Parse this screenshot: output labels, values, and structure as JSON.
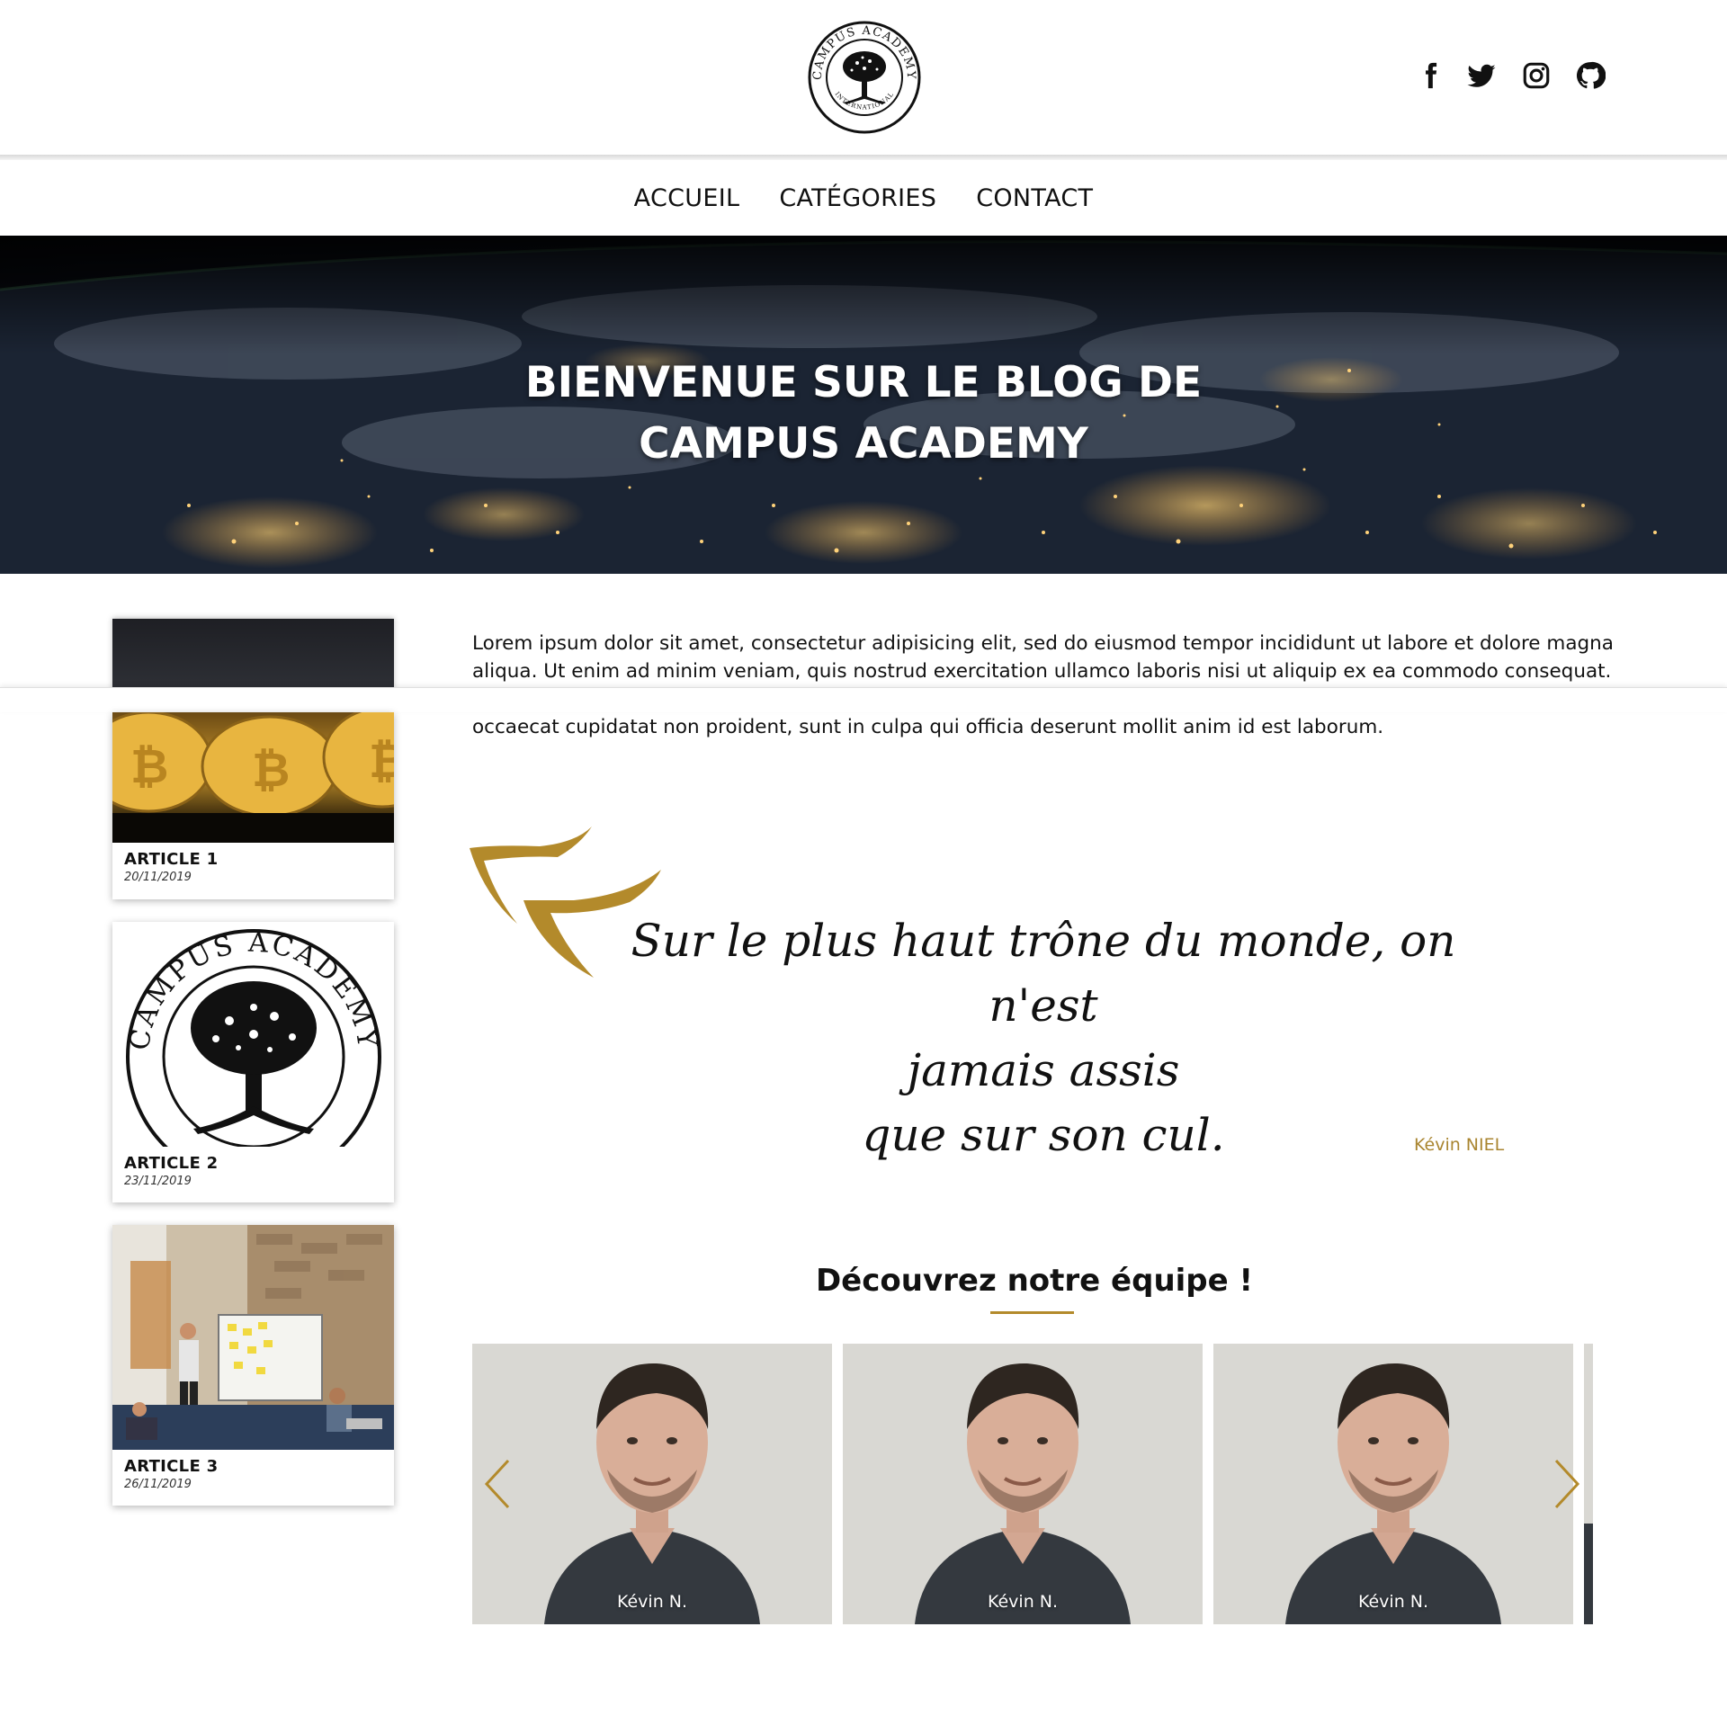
{
  "header": {
    "logo_text": "CAMPUS ACADEMY INTERNATIONAL",
    "social_icons": [
      "facebook-icon",
      "twitter-icon",
      "instagram-icon",
      "github-icon"
    ]
  },
  "nav": {
    "items": [
      {
        "label": "ACCUEIL"
      },
      {
        "label": "CATÉGORIES"
      },
      {
        "label": "CONTACT"
      }
    ]
  },
  "hero": {
    "title_line1": "BIENVENUE SUR LE BLOG DE",
    "title_line2": "CAMPUS ACADEMY"
  },
  "articles": [
    {
      "title": "ARTICLE 1",
      "date": "20/11/2019"
    },
    {
      "title": "ARTICLE 2",
      "date": "23/11/2019"
    },
    {
      "title": "ARTICLE 3",
      "date": "26/11/2019"
    }
  ],
  "intro": {
    "line1": "Lorem ipsum dolor sit amet, consectetur adipisicing elit, sed do eiusmod tempor incididunt ut labore et dolore magna",
    "line2": "aliqua. Ut enim ad minim veniam, quis nostrud exercitation ullamco laboris nisi ut aliquip ex ea commodo consequat.",
    "line3": "occaecat cupidatat non proident, sunt in culpa qui officia deserunt mollit anim id est laborum."
  },
  "quote": {
    "line1": "Sur le plus haut trône du monde, on n'est",
    "line2": "jamais assis",
    "line3": "que sur son cul.",
    "author": "Kévin NIEL"
  },
  "team": {
    "title": "Découvrez notre équipe !",
    "members": [
      {
        "name": "Kévin N."
      },
      {
        "name": "Kévin N."
      },
      {
        "name": "Kévin N."
      }
    ]
  },
  "colors": {
    "accent": "#b38a2b",
    "author": "#a98530",
    "text": "#111111",
    "hero_dark": "#0b0f18"
  }
}
